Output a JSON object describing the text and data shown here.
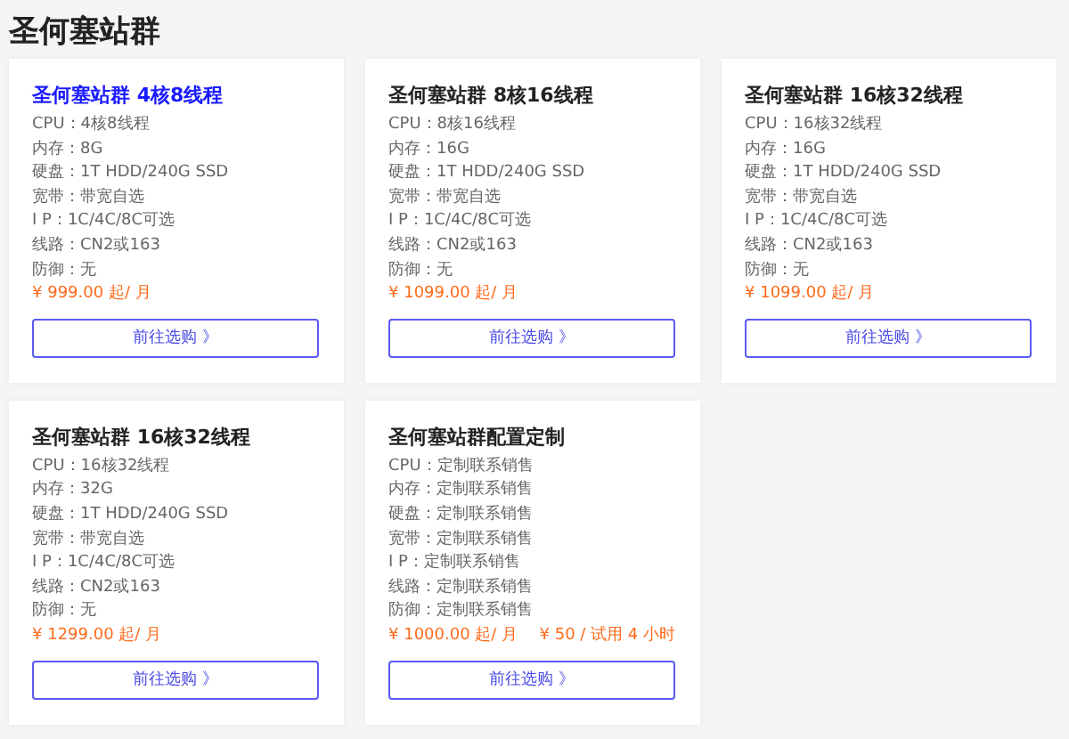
{
  "heading": "圣何塞站群",
  "cards": [
    {
      "title": "圣何塞站群 4核8线程",
      "selected": true,
      "specs": [
        "CPU：4核8线程",
        "内存：8G",
        "硬盘：1T HDD/240G SSD",
        "宽带：带宽自选",
        "I P：1C/4C/8C可选",
        "线路：CN2或163",
        "防御：无"
      ],
      "price": "¥ 999.00 起/ 月",
      "button": "前往选购 》"
    },
    {
      "title": "圣何塞站群 8核16线程",
      "selected": false,
      "specs": [
        "CPU：8核16线程",
        "内存：16G",
        "硬盘：1T HDD/240G SSD",
        "宽带：带宽自选",
        "I P：1C/4C/8C可选",
        "线路：CN2或163",
        "防御：无"
      ],
      "price": "¥ 1099.00 起/ 月",
      "button": "前往选购 》"
    },
    {
      "title": "圣何塞站群 16核32线程",
      "selected": false,
      "specs": [
        "CPU：16核32线程",
        "内存：16G",
        "硬盘：1T HDD/240G SSD",
        "宽带：带宽自选",
        "I P：1C/4C/8C可选",
        "线路：CN2或163",
        "防御：无"
      ],
      "price": "¥ 1099.00 起/ 月",
      "button": "前往选购 》"
    },
    {
      "title": "圣何塞站群 16核32线程",
      "selected": false,
      "specs": [
        "CPU：16核32线程",
        "内存：32G",
        "硬盘：1T HDD/240G SSD",
        "宽带：带宽自选",
        "I P：1C/4C/8C可选",
        "线路：CN2或163",
        "防御：无"
      ],
      "price": "¥ 1299.00 起/ 月",
      "button": "前往选购 》"
    },
    {
      "title": "圣何塞站群配置定制",
      "selected": false,
      "specs": [
        "CPU：定制联系销售",
        "内存：定制联系销售",
        "硬盘：定制联系销售",
        "宽带：定制联系销售",
        "I P：定制联系销售",
        "线路：定制联系销售",
        "防御：定制联系销售"
      ],
      "price": "¥ 1000.00 起/ 月",
      "trial": "¥ 50 / 试用 4 小时",
      "button": "前往选购 》"
    }
  ]
}
